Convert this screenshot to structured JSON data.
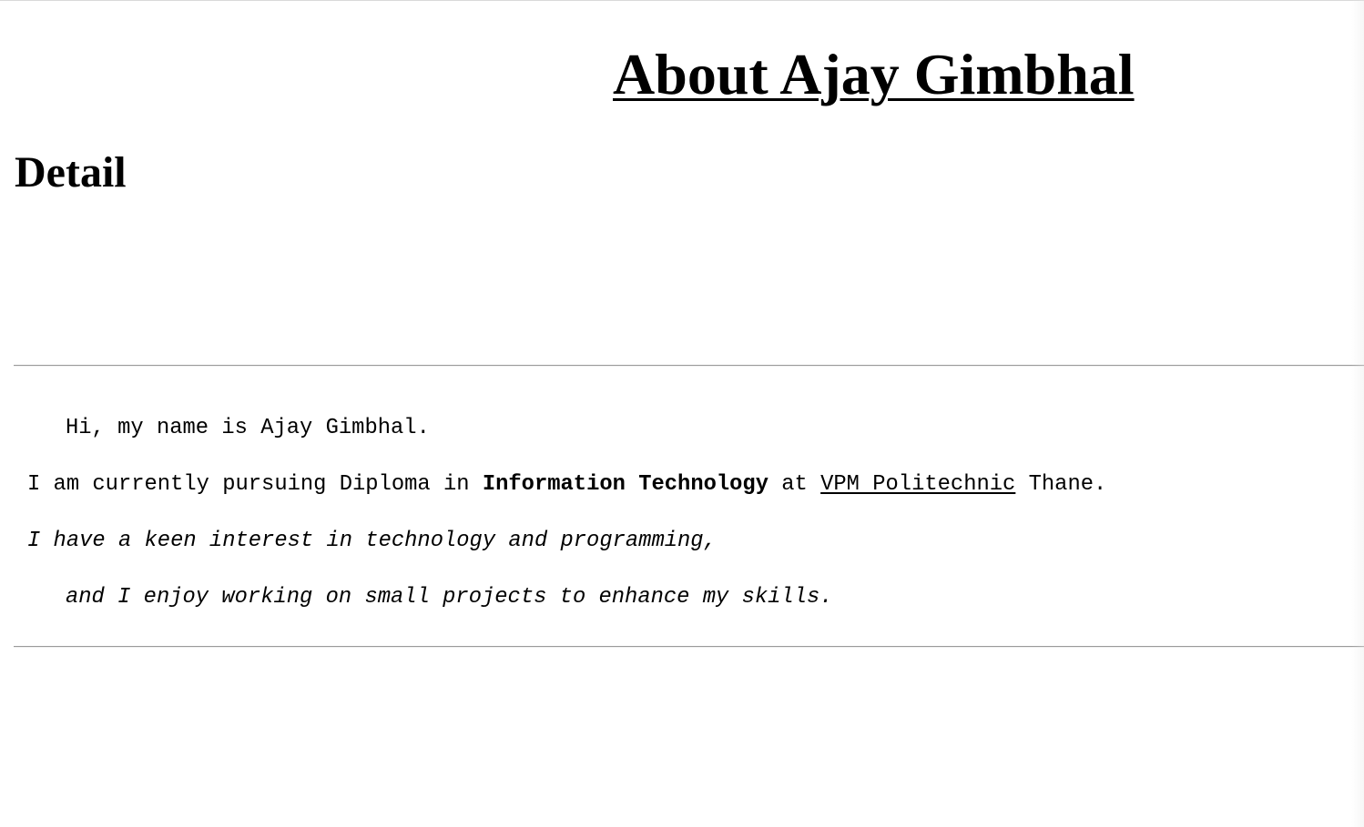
{
  "page": {
    "title": "About Ajay Gimbhal",
    "section_heading": "Detail"
  },
  "intro": {
    "greeting": "Hi, my name is Ajay Gimbhal.",
    "study_prefix": "I am currently pursuing Diploma in ",
    "field": "Information Technology",
    "study_middle": " at ",
    "college_link": "VPM Politechnic",
    "study_suffix": " Thane.",
    "interest_line": "I have a keen interest in technology and programming,",
    "projects_line": "and I enjoy working on small projects to enhance my skills."
  }
}
